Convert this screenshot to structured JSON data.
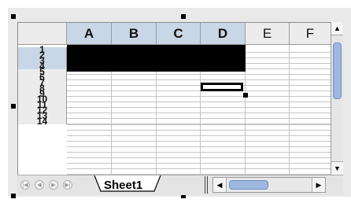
{
  "columns": [
    {
      "label": "A",
      "selected": true
    },
    {
      "label": "B",
      "selected": true
    },
    {
      "label": "C",
      "selected": true
    },
    {
      "label": "D",
      "selected": true
    },
    {
      "label": "E",
      "selected": false
    },
    {
      "label": "F",
      "selected": false
    }
  ],
  "rows": [
    "1",
    "2",
    "3",
    "4",
    "5",
    "6",
    "7",
    "8",
    "9",
    "10",
    "11",
    "12",
    "13",
    "14"
  ],
  "selected_rows": [
    "1",
    "2",
    "3",
    "4"
  ],
  "selection_range": "A1:D4",
  "active_cell": "D5",
  "sheet_tab": {
    "label": "Sheet1"
  },
  "colors": {
    "selected_header": "#c8d6e6",
    "header": "#ececec",
    "selection_fill": "#000000",
    "scroll_thumb": "#9db8de"
  },
  "icons": {
    "nav_first": "first-sheet-icon",
    "nav_prev": "prev-sheet-icon",
    "nav_next": "next-sheet-icon",
    "nav_last": "last-sheet-icon",
    "scroll_up": "arrow-up-icon",
    "scroll_down": "arrow-down-icon",
    "scroll_left": "arrow-left-icon",
    "scroll_right": "arrow-right-icon"
  }
}
